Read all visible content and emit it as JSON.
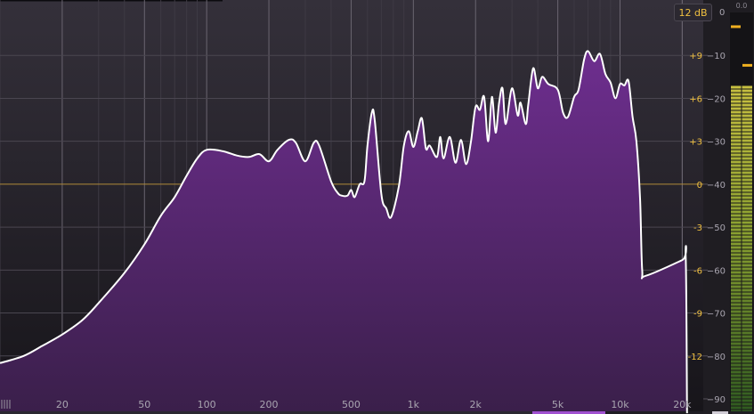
{
  "range_button": {
    "label": "12 dB"
  },
  "meter": {
    "peak_label": "0.0",
    "zero_label": "0",
    "level_db": -17,
    "peak_hold_db": -12,
    "peak_marker_db": -3
  },
  "colors": {
    "fill_top": "#6e2e8f",
    "fill_bottom": "#3a1f4a",
    "curve": "#ffffff",
    "gain_label": "#f0c040",
    "db_label": "#a9a5b0",
    "freq_label": "#a9a5b0",
    "zero_line": "#b08a3a"
  },
  "chart_data": {
    "type": "area",
    "x_scale": "log",
    "xlim": [
      10,
      22000
    ],
    "x_tick_labels": [
      {
        "label": "20",
        "value": 20
      },
      {
        "label": "50",
        "value": 50
      },
      {
        "label": "100",
        "value": 100
      },
      {
        "label": "200",
        "value": 200
      },
      {
        "label": "500",
        "value": 500
      },
      {
        "label": "1k",
        "value": 1000
      },
      {
        "label": "2k",
        "value": 2000
      },
      {
        "label": "5k",
        "value": 5000
      },
      {
        "label": "10k",
        "value": 10000
      },
      {
        "label": "20k",
        "value": 20000
      }
    ],
    "gain_axis": {
      "range": [
        -15,
        12
      ],
      "ticks": [
        {
          "label": "+9",
          "value": 9
        },
        {
          "label": "+6",
          "value": 6
        },
        {
          "label": "+3",
          "value": 3
        },
        {
          "label": "0",
          "value": 0
        },
        {
          "label": "-3",
          "value": -3
        },
        {
          "label": "-6",
          "value": -6
        },
        {
          "label": "-9",
          "value": -9
        },
        {
          "label": "-12",
          "value": -12
        }
      ]
    },
    "db_axis": {
      "range": [
        -90,
        0
      ],
      "ticks": [
        {
          "label": "−10",
          "value": -10
        },
        {
          "label": "−20",
          "value": -20
        },
        {
          "label": "−30",
          "value": -30
        },
        {
          "label": "−40",
          "value": -40
        },
        {
          "label": "−50",
          "value": -50
        },
        {
          "label": "−60",
          "value": -60
        },
        {
          "label": "−70",
          "value": -70
        },
        {
          "label": "−80",
          "value": -80
        },
        {
          "label": "−90",
          "value": -90
        }
      ]
    },
    "grid": true,
    "series": [
      {
        "x": [
          10,
          13,
          16,
          20,
          25,
          30,
          40,
          50,
          60,
          70,
          80,
          90,
          100,
          120,
          140,
          160,
          180,
          200,
          220,
          250,
          270,
          300,
          330,
          350,
          400,
          430,
          450,
          480,
          500,
          520,
          550,
          580,
          600,
          630,
          650,
          700,
          740,
          780,
          850,
          900,
          950,
          1000,
          1050,
          1100,
          1150,
          1200,
          1300,
          1350,
          1400,
          1500,
          1600,
          1700,
          1800,
          1900,
          2000,
          2100,
          2200,
          2300,
          2400,
          2500,
          2600,
          2700,
          2800,
          3000,
          3200,
          3300,
          3500,
          3600,
          3800,
          4000,
          4200,
          4500,
          5000,
          5300,
          5600,
          6000,
          6300,
          6700,
          7000,
          7500,
          8000,
          8500,
          9000,
          9500,
          10000,
          10500,
          11000,
          11500,
          12000,
          12500,
          12800,
          13300,
          20000,
          20800,
          21100
        ],
        "y": [
          -12.5,
          -12.0,
          -11.3,
          -10.5,
          -9.5,
          -8.3,
          -6.2,
          -4.2,
          -2.2,
          -0.9,
          0.6,
          1.8,
          2.4,
          2.3,
          2.0,
          1.9,
          2.1,
          1.6,
          2.4,
          3.1,
          2.9,
          1.6,
          2.9,
          2.7,
          0.2,
          -0.6,
          -0.8,
          -0.8,
          -0.4,
          -0.9,
          0.0,
          0.2,
          2.7,
          5.0,
          4.5,
          -0.7,
          -1.7,
          -2.3,
          -0.2,
          2.7,
          3.7,
          2.6,
          3.7,
          4.6,
          2.5,
          2.7,
          1.9,
          3.3,
          1.8,
          3.3,
          1.5,
          3.1,
          1.4,
          3.0,
          5.4,
          5.2,
          6.1,
          3.0,
          6.1,
          3.6,
          5.7,
          6.7,
          4.2,
          6.7,
          4.8,
          5.7,
          4.2,
          5.6,
          8.1,
          6.7,
          7.5,
          7.0,
          6.6,
          5.0,
          4.7,
          6.1,
          6.6,
          8.7,
          9.3,
          8.6,
          9.1,
          7.7,
          7.1,
          6.0,
          7.0,
          6.9,
          7.2,
          4.7,
          3.0,
          -1.0,
          -6.0,
          -6.4,
          -5.3,
          -5.1,
          -16
        ]
      }
    ]
  }
}
